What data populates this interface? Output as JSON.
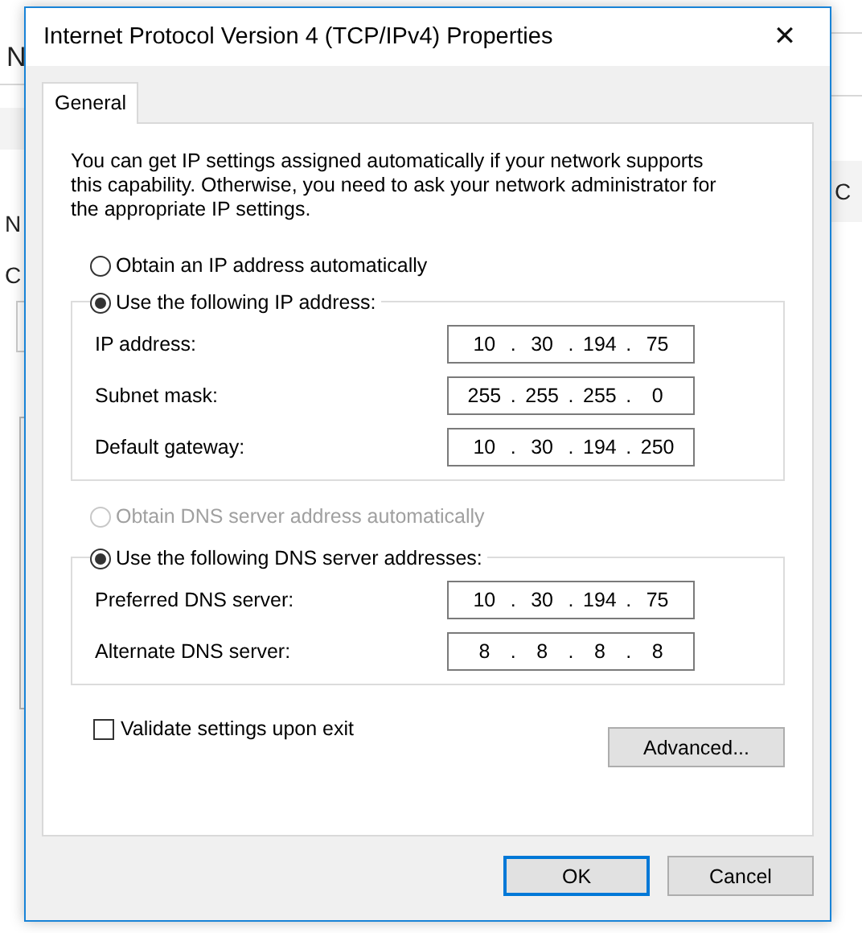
{
  "background_window": {
    "left_fragments": [
      "N",
      "N",
      "C"
    ],
    "right_fragments": [
      "C"
    ]
  },
  "window": {
    "title": "Internet Protocol Version 4 (TCP/IPv4) Properties",
    "close": "✕"
  },
  "tabs": [
    {
      "label": "General",
      "selected": true
    }
  ],
  "description": "You can get IP settings assigned automatically if your network supports this capability. Otherwise, you need to ask your network administrator for the appropriate IP settings.",
  "ip_separator": ".",
  "ip_auto": {
    "label": "Obtain an IP address automatically",
    "selected": false,
    "disabled": false
  },
  "ip_manual": {
    "label": "Use the following IP address:",
    "selected": true,
    "disabled": false,
    "fields": [
      {
        "label": "IP address:",
        "octets": [
          "10",
          "30",
          "194",
          "75"
        ]
      },
      {
        "label": "Subnet mask:",
        "octets": [
          "255",
          "255",
          "255",
          "0"
        ]
      },
      {
        "label": "Default gateway:",
        "octets": [
          "10",
          "30",
          "194",
          "250"
        ]
      }
    ]
  },
  "dns_auto": {
    "label": "Obtain DNS server address automatically",
    "selected": false,
    "disabled": true
  },
  "dns_manual": {
    "label": "Use the following DNS server addresses:",
    "selected": true,
    "disabled": false,
    "fields": [
      {
        "label": "Preferred DNS server:",
        "octets": [
          "10",
          "30",
          "194",
          "75"
        ]
      },
      {
        "label": "Alternate DNS server:",
        "octets": [
          "8",
          "8",
          "8",
          "8"
        ]
      }
    ]
  },
  "validate": {
    "label": "Validate settings upon exit",
    "checked": false
  },
  "advanced_button": "Advanced...",
  "buttons": [
    {
      "label": "OK",
      "default": true
    },
    {
      "label": "Cancel",
      "default": false
    }
  ]
}
